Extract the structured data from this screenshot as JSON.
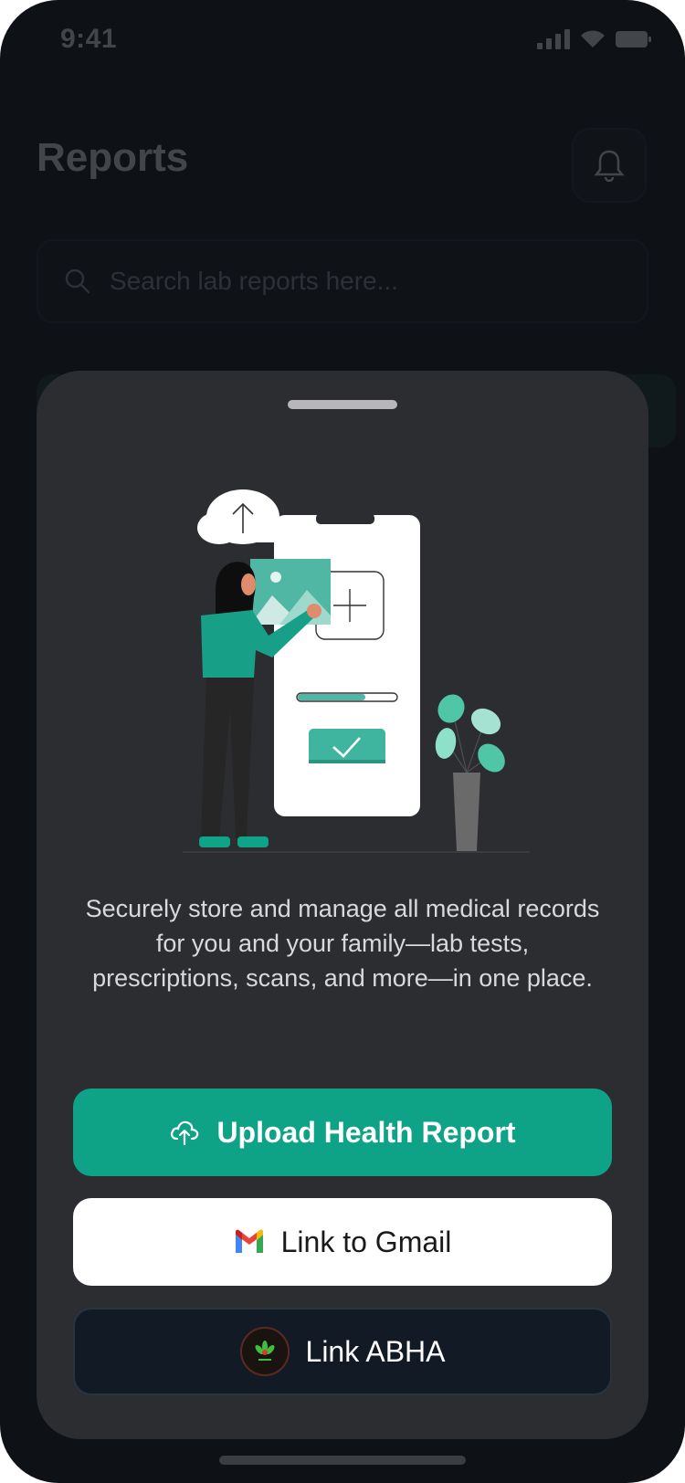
{
  "status_bar": {
    "time": "9:41"
  },
  "header": {
    "title": "Reports"
  },
  "search": {
    "placeholder": "Search lab reports here..."
  },
  "sheet": {
    "description": "Securely store and manage all medical records for you and your family—lab tests, prescriptions, scans, and more—in one place.",
    "buttons": {
      "upload": {
        "label": "Upload Health Report",
        "icon": "cloud-upload-icon"
      },
      "gmail": {
        "label": "Link to Gmail",
        "icon": "gmail-icon"
      },
      "abha": {
        "label": "Link ABHA",
        "icon": "abha-logo"
      }
    }
  },
  "colors": {
    "accent": "#0ea387",
    "sheet_bg": "#2c2d31",
    "screen_bg": "#0e1116",
    "abha_button_bg": "#121a26"
  }
}
